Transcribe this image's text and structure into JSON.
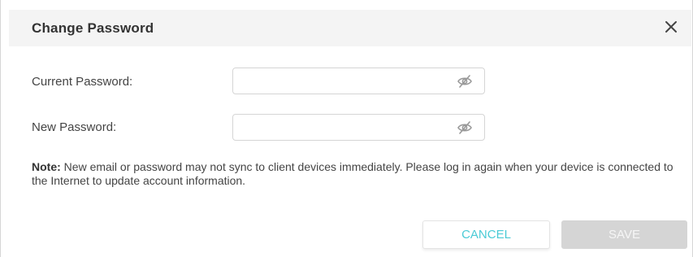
{
  "dialog": {
    "title": "Change Password",
    "close_icon": "close-icon"
  },
  "fields": {
    "current_password": {
      "label": "Current Password:",
      "value": "",
      "placeholder": "",
      "visibility_icon": "eye-slash-icon"
    },
    "new_password": {
      "label": "New Password:",
      "value": "",
      "placeholder": "",
      "visibility_icon": "eye-slash-icon"
    }
  },
  "note": {
    "prefix": "Note:",
    "text": " New email or password may not sync to client devices immediately. Please log in again when your device is connected to the Internet to update account information."
  },
  "buttons": {
    "cancel": "CANCEL",
    "save": "SAVE"
  },
  "colors": {
    "accent": "#4acbd6",
    "disabled_button": "#d5d5d5",
    "header_bg": "#f4f4f4"
  }
}
